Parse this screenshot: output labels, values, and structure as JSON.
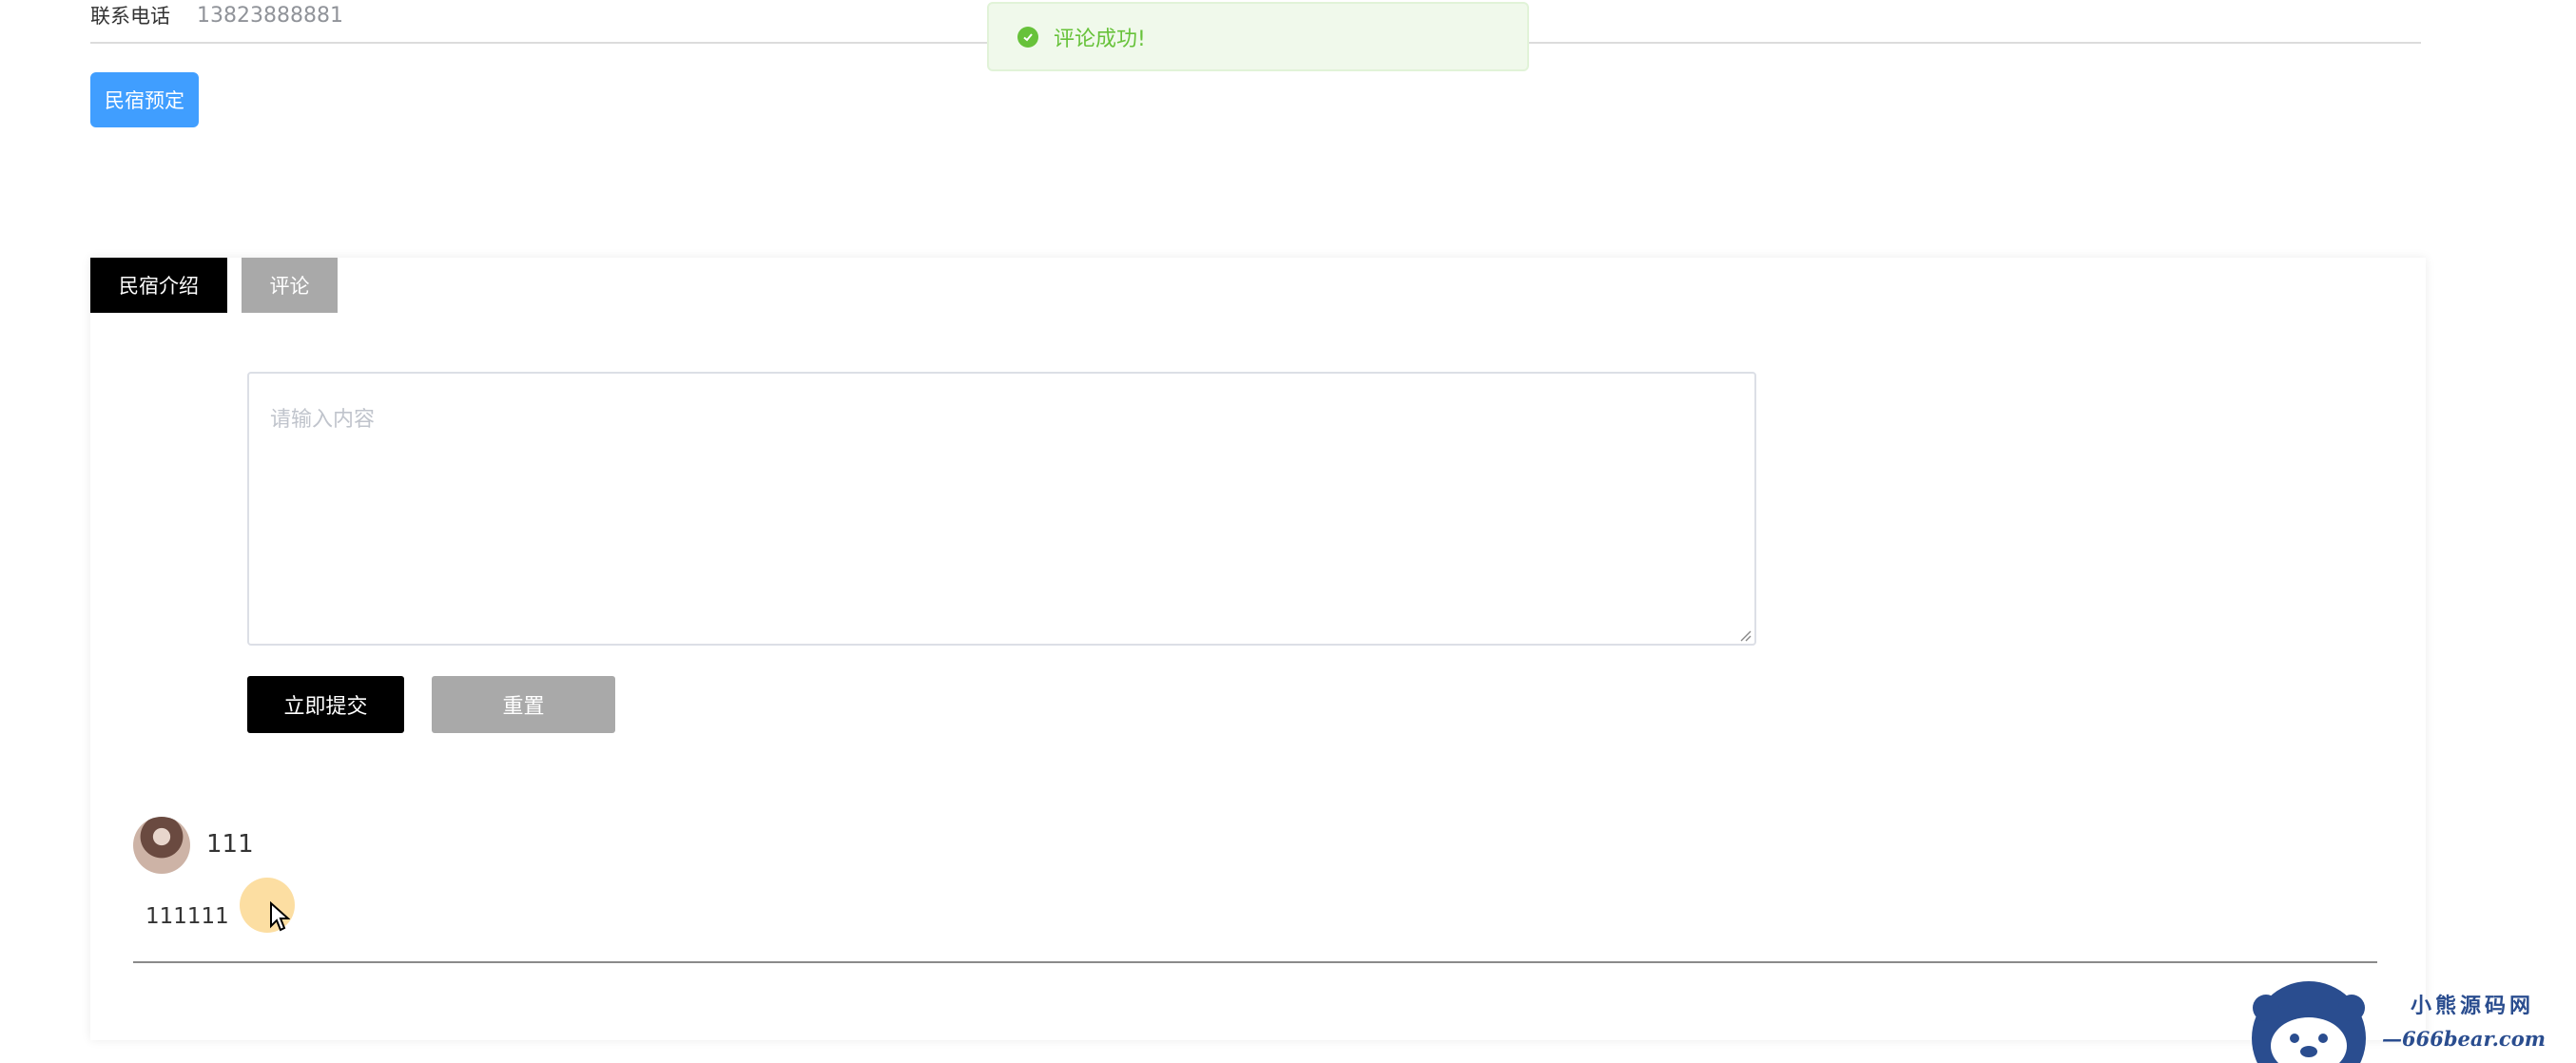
{
  "contact": {
    "label": "联系电话",
    "value": "13823888881"
  },
  "toast": {
    "message": "评论成功!",
    "icon": "check-circle-icon",
    "color": "#67c23a"
  },
  "actions": {
    "book_label": "民宿预定"
  },
  "tabs": [
    {
      "label": "民宿介绍",
      "active": true
    },
    {
      "label": "评论",
      "active": false
    }
  ],
  "comment_form": {
    "label": "评论",
    "required_mark": "*",
    "placeholder": "请输入内容",
    "value": "",
    "submit_label": "立即提交",
    "reset_label": "重置"
  },
  "comments": [
    {
      "username": "111",
      "content": "111111"
    }
  ],
  "watermark": {
    "name": "小熊源码网",
    "url": "—666bear.com—"
  },
  "colors": {
    "primary": "#409eff",
    "dark": "#000000",
    "gray": "#a9a9a9",
    "success": "#67c23a"
  }
}
